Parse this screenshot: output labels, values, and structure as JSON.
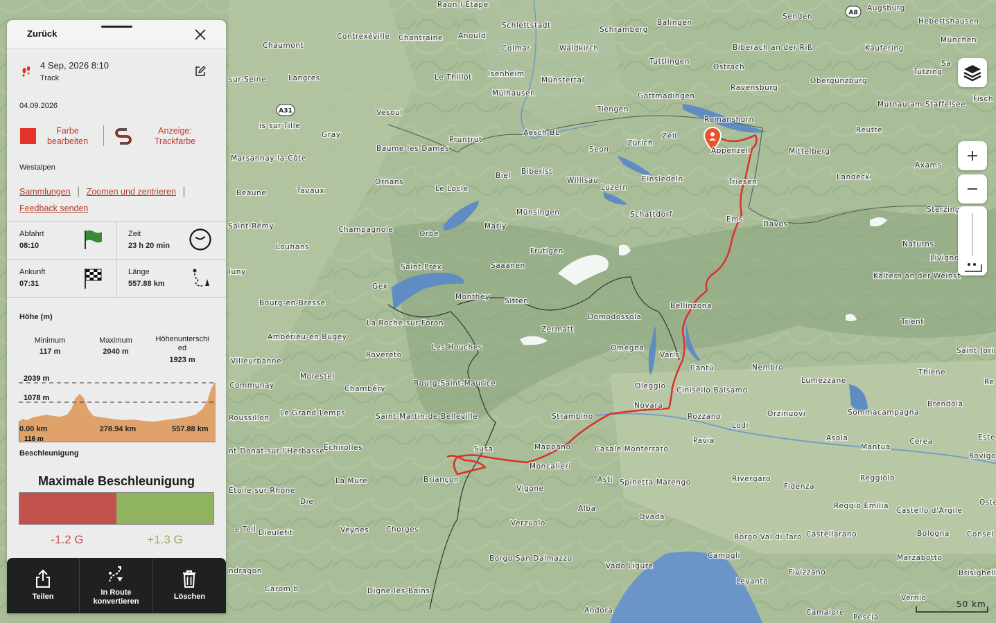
{
  "panel": {
    "back_label": "Zurück",
    "track_datetime": "4 Sep, 2026 8:10",
    "track_type": "Track",
    "date": "04.09.2026",
    "color_action_line1": "Farbe",
    "color_action_line2": "bearbeiten",
    "display_action_line1": "Anzeige:",
    "display_action_line2": "Trackfarbe",
    "region": "Westalpen",
    "links": [
      "Sammlungen",
      "Zoomen und zentrieren",
      "Feedback senden"
    ],
    "departure_label": "Abfahrt",
    "departure_value": "08:10",
    "time_label": "Zeit",
    "time_value": "23 h 20 min",
    "arrival_label": "Ankunft",
    "arrival_value": "07:31",
    "length_label": "Länge",
    "length_value": "557.88 km",
    "elevation_title": "Höhe (m)",
    "min_label": "Minimum",
    "min_value": "117 m",
    "max_label": "Maximum",
    "max_value": "2040 m",
    "diff_label_line1": "Höhenunterschi",
    "diff_label_line2": "ed",
    "diff_value": "1923 m",
    "chart_top_label": "2039 m",
    "chart_mid_label": "1078 m",
    "chart_bottom_label": "116 m",
    "x_start": "0.00 km",
    "x_mid": "278.94 km",
    "x_end": "557.88 km",
    "accel_section": "Beschleunigung",
    "accel_title": "Maximale Beschleunigung",
    "accel_min": "-1.2 G",
    "accel_max": "+1.3 G",
    "track_color": "#e53a2c",
    "accel_neg_color": "#c3514b",
    "accel_pos_color": "#8fb35f"
  },
  "bottom_bar": {
    "share": "Teilen",
    "convert_line1": "In Route",
    "convert_line2": "konvertieren",
    "delete": "Löschen"
  },
  "map": {
    "scale_label": "50 km",
    "shields": [
      "A8",
      "A31"
    ],
    "labels": [
      "Raon-l'Étape",
      "Schlettstadt",
      "Balingen",
      "Senden",
      "Augsburg",
      "Hebertshausen",
      "Schramberg",
      "Contrexéville",
      "Chantraine",
      "Anould",
      "Chaumont",
      "Colmar",
      "Waldkirch",
      "Biberach an der Riß",
      "Kaufering",
      "München",
      "Tuttlingen",
      "Ostrach",
      "Sa",
      "sur-Seine",
      "Langres",
      "Le Thillot",
      "Isenheim",
      "Münstertal",
      "Ravensburg",
      "Obergünzburg",
      "Tutzing",
      "Mülhausen",
      "Gottmadingen",
      "Murnau am Staffelsee",
      "Fisch",
      "Vesoul",
      "Tiengen",
      "Romanshorn",
      "is-sur-Tille",
      "Aesch BL",
      "Zell",
      "Reutte",
      "Gray",
      "Pruntrut",
      "Zürich",
      "Baume-les-Dames",
      "Seon",
      "Appenzell",
      "Mittelberg",
      "Axams",
      "Marsannay-la-Côte",
      "Biberist",
      "Einsiedeln",
      "Landeck",
      "Ornans",
      "Biel",
      "Willisau",
      "Luzern",
      "Triesen",
      "Beaune",
      "Tavaux",
      "Le Locle",
      "Sterzing",
      "Münsingen",
      "Schattdorf",
      "Ems",
      "Davos",
      "Saint-Rémy",
      "Champagnole",
      "Marly",
      "Orbe",
      "Naturns",
      "Louhans",
      "Frutigen",
      "Livigno",
      "Saint-Prex",
      "Saaanen",
      "Kaltern an der Weinst",
      "luny",
      "Gex",
      "Monthey",
      "Sitten",
      "Bellinzona",
      "Bourg-en-Bresse",
      "La Roche-sur-Foron",
      "Domodossola",
      "Trient",
      "Zermatt",
      "Ambérieu-en-Bugey",
      "Les Houches",
      "Omegna",
      "Varis",
      "Rovereto",
      "Saint-Jorioz",
      "Villeurbanne",
      "Cantù",
      "Nembro",
      "Morestel",
      "Thiene",
      "Communay",
      "Chambéry",
      "Bourg-Saint-Maurice",
      "Oleggio",
      "Cinisello Balsamo",
      "Lumezzane",
      "Re",
      "Novara",
      "Brendola",
      "Roussillon",
      "Le Grand-Lemps",
      "Saint-Martin-de-Belleville",
      "Strambino",
      "Rozzano",
      "Orzinuovi",
      "Sommacampagna",
      "Lodi",
      "Este",
      "nt-Donat-sur-l'Herbasse",
      "Échirolles",
      "Susa",
      "Mappano",
      "Casale Monferrato",
      "Pavia",
      "Asola",
      "Mantua",
      "Cerea",
      "Rovigo",
      "Moncalieri",
      "Rivergaro",
      "Reggiolo",
      "La Mure",
      "Briançon",
      "Asti",
      "Spinetta Marengo",
      "Fidenza",
      "Étoile-sur-Rhône",
      "Vigone",
      "Reggio Emilia",
      "Castello d'Argile",
      "Oste",
      "Die",
      "Alba",
      "Ovada",
      "Dieulefit",
      "e Teil",
      "Veynes",
      "Chorges",
      "Verzuolo",
      "Borgo Val di Taro",
      "Castellarano",
      "Bologna",
      "Consel",
      "Borgo San Dalmazzo",
      "Camogli",
      "Marzabotto",
      "ndragon",
      "Vado Ligure",
      "Fivizzano",
      "Brisighell",
      "Carom b",
      "Digne-les-Bains",
      "Levanto",
      "Vernio",
      "Andora",
      "Camaiore",
      "Pescia"
    ]
  }
}
